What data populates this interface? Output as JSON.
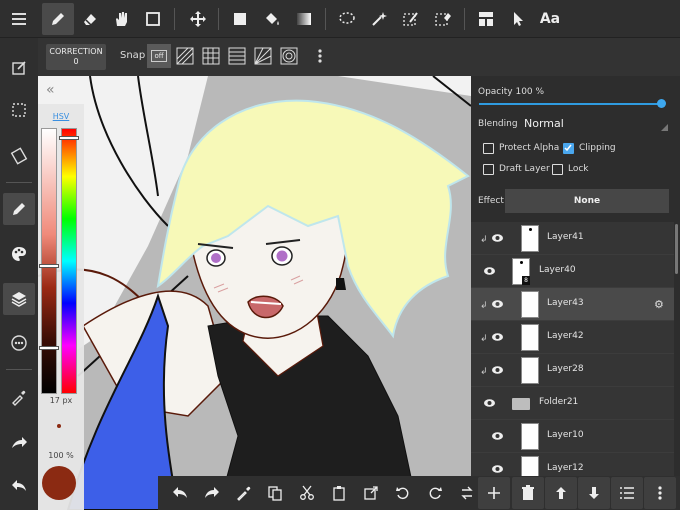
{
  "toolbar": {
    "font_label": "Aa"
  },
  "subbar": {
    "correction_label": "CORRECTION",
    "correction_value": "0",
    "snap_label": "Snap",
    "snap_off_label": "off"
  },
  "color_panel": {
    "mode_label": "HSV",
    "brush_size": "17 px",
    "brush_opacity": "100 %",
    "current_color": "#8b2a12"
  },
  "layer_properties": {
    "opacity_label": "Opacity 100 %",
    "opacity_value": 1.0,
    "blending_label": "Blending",
    "blending_value": "Normal",
    "protect_alpha_label": "Protect Alpha",
    "protect_alpha_checked": false,
    "clipping_label": "Clipping",
    "clipping_checked": true,
    "draft_layer_label": "Draft Layer",
    "draft_layer_checked": false,
    "lock_label": "Lock",
    "lock_checked": false,
    "effect_label": "Effect",
    "effect_value": "None"
  },
  "layers": [
    {
      "name": "Layer41",
      "clipped": true
    },
    {
      "name": "Layer40",
      "clipped": false,
      "badge": "8"
    },
    {
      "name": "Layer43",
      "clipped": true,
      "selected": true
    },
    {
      "name": "Layer42",
      "clipped": true
    },
    {
      "name": "Layer28",
      "clipped": true
    },
    {
      "name": "Folder21",
      "clipped": false,
      "folder": true
    },
    {
      "name": "Layer10",
      "clipped": false
    },
    {
      "name": "Layer12",
      "clipped": false
    }
  ],
  "colors": {
    "accent": "#3da8ef",
    "background": "#2d2d2d",
    "selected_row": "#4a4a4a"
  }
}
